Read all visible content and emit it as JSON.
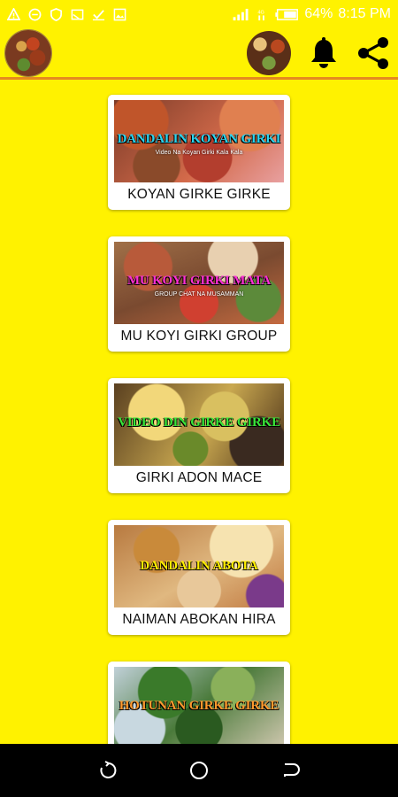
{
  "status_bar": {
    "battery": "64%",
    "time": "8:15 PM",
    "left_icons": [
      "warning-icon",
      "minus-circle-icon",
      "shield-icon",
      "cast-icon",
      "checkbox-icon",
      "image-icon"
    ],
    "right_icons": [
      "signal-icon",
      "wifi-icon",
      "battery-icon"
    ]
  },
  "app_bar": {
    "avatar_icon": "food-avatar",
    "actions": [
      "food-thumbnail",
      "bell-icon",
      "share-icon"
    ]
  },
  "colors": {
    "background": "#fff200",
    "divider": "#e58a1f",
    "card": "#ffffff",
    "nav_bar": "#000000"
  },
  "cards": [
    {
      "image_title": "DANDALIN KOYAN GIRKI",
      "image_subtitle": "Video Na Koyan Girki Kala Kala",
      "title_color": "#2ad4f0",
      "label": "KOYAN GIRKE GIRKE"
    },
    {
      "image_title": "MU KOYI GIRKI MATA",
      "image_subtitle": "GROUP CHAT NA MUSAMMAN",
      "title_color": "#ff2fd6",
      "label": "MU KOYI GIRKI GROUP"
    },
    {
      "image_title": "VIDEO DIN GIRKE GIRKE",
      "image_subtitle": "",
      "title_color": "#39e639",
      "label": "GIRKI ADON MACE"
    },
    {
      "image_title": "DANDALIN ABOTA",
      "image_subtitle": "",
      "title_color": "#ffee00",
      "label": "NAIMAN ABOKAN HIRA"
    },
    {
      "image_title": "HOTUNAN GIRKE GIRKE",
      "image_subtitle": "",
      "title_color": "#ff9a2e",
      "label": ""
    }
  ],
  "nav_bar": {
    "buttons": [
      "recent-apps-icon",
      "home-icon",
      "back-icon"
    ]
  }
}
